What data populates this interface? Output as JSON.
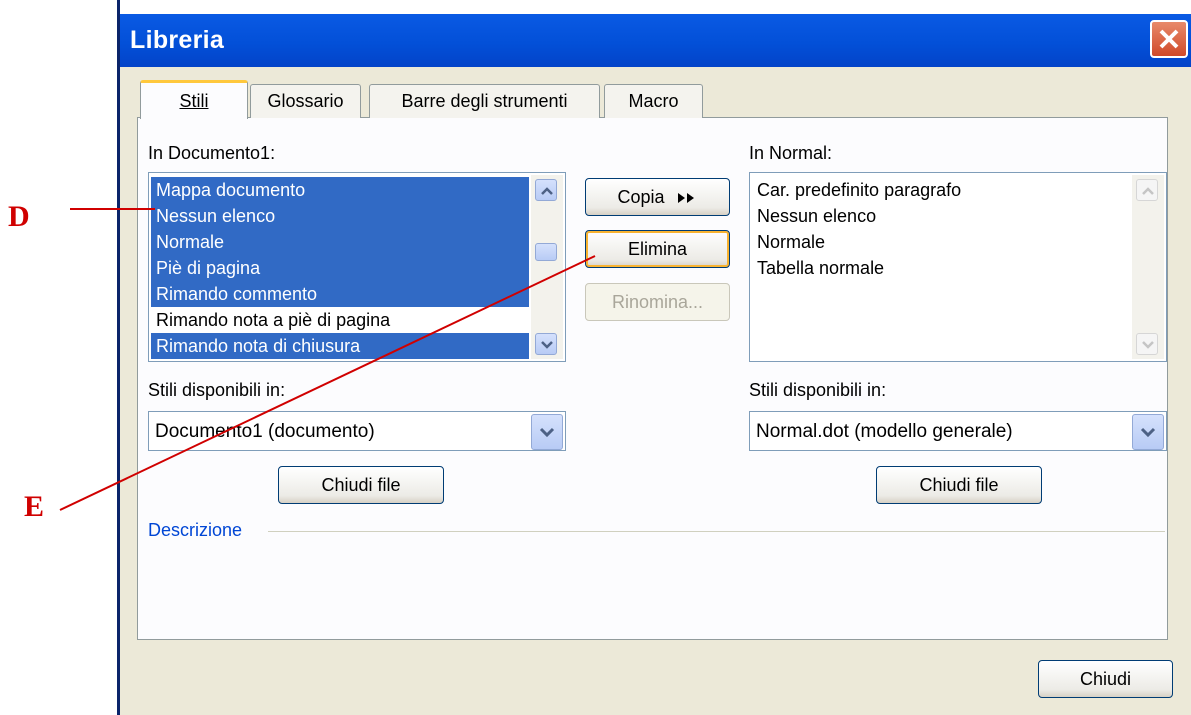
{
  "window": {
    "title": "Libreria"
  },
  "tabs": [
    {
      "label": "Stili",
      "active": true
    },
    {
      "label": "Glossario"
    },
    {
      "label": "Barre degli strumenti"
    },
    {
      "label": "Macro"
    }
  ],
  "left_pane": {
    "label": "In Documento1:",
    "items": [
      {
        "label": "Mappa documento",
        "selected": true
      },
      {
        "label": "Nessun elenco",
        "selected": true
      },
      {
        "label": "Normale",
        "selected": true
      },
      {
        "label": "Piè di pagina",
        "selected": true
      },
      {
        "label": "Rimando commento",
        "selected": true
      },
      {
        "label": "Rimando nota a piè di pagina",
        "selected": false
      },
      {
        "label": "Rimando nota di chiusura",
        "selected": true
      }
    ],
    "available_label": "Stili disponibili in:",
    "available_value": "Documento1 (documento)",
    "close_file_label": "Chiudi file"
  },
  "right_pane": {
    "label": "In Normal:",
    "items": [
      {
        "label": "Car. predefinito paragrafo"
      },
      {
        "label": "Nessun elenco"
      },
      {
        "label": "Normale"
      },
      {
        "label": "Tabella normale"
      }
    ],
    "available_label": "Stili disponibili in:",
    "available_value": "Normal.dot (modello generale)",
    "close_file_label": "Chiudi file"
  },
  "actions": {
    "copy_label": "Copia",
    "delete_label": "Elimina",
    "rename_label": "Rinomina..."
  },
  "description": {
    "label": "Descrizione"
  },
  "footer": {
    "close_label": "Chiudi"
  },
  "annotations": {
    "d": "D",
    "e": "E",
    "color": "#d00000"
  },
  "colors": {
    "selection": "#316ac5",
    "titlebar": "#0350d8",
    "dialog": "#ece9d8"
  }
}
